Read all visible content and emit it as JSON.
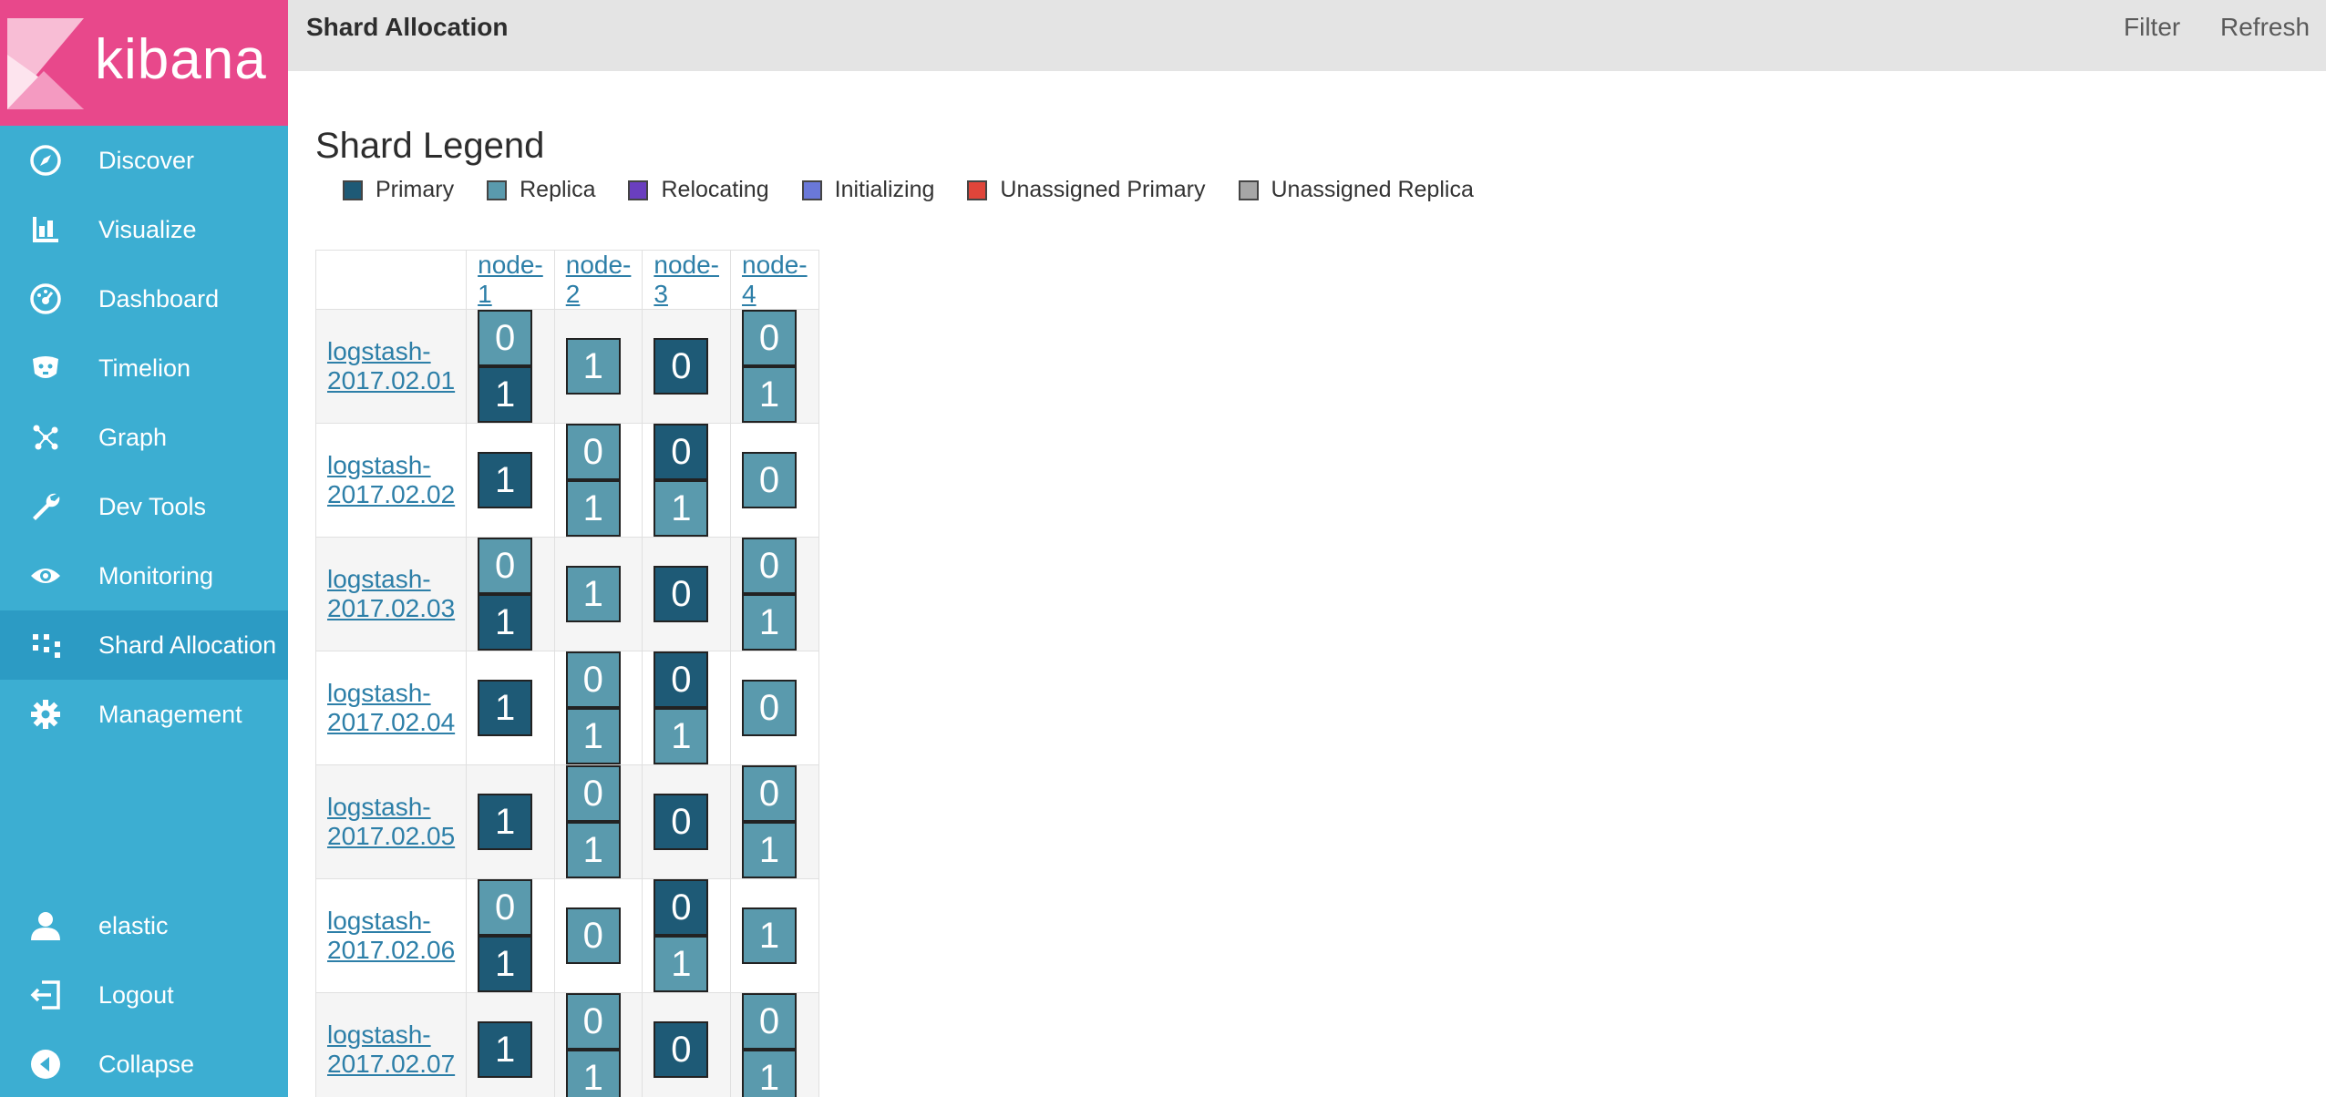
{
  "logo": {
    "text": "kibana"
  },
  "nav": {
    "items": [
      {
        "label": "Discover",
        "icon": "compass-icon",
        "active": false
      },
      {
        "label": "Visualize",
        "icon": "bar-chart-icon",
        "active": false
      },
      {
        "label": "Dashboard",
        "icon": "dashboard-icon",
        "active": false
      },
      {
        "label": "Timelion",
        "icon": "timelion-icon",
        "active": false
      },
      {
        "label": "Graph",
        "icon": "graph-icon",
        "active": false
      },
      {
        "label": "Dev Tools",
        "icon": "wrench-icon",
        "active": false
      },
      {
        "label": "Monitoring",
        "icon": "eye-icon",
        "active": false
      },
      {
        "label": "Shard Allocation",
        "icon": "shard-grid-icon",
        "active": true
      },
      {
        "label": "Management",
        "icon": "gear-icon",
        "active": false
      }
    ],
    "bottom": [
      {
        "label": "elastic",
        "icon": "user-icon"
      },
      {
        "label": "Logout",
        "icon": "logout-icon"
      },
      {
        "label": "Collapse",
        "icon": "collapse-icon"
      }
    ]
  },
  "topbar": {
    "title": "Shard Allocation",
    "filter": "Filter",
    "refresh": "Refresh"
  },
  "legend": {
    "title": "Shard Legend",
    "items": [
      {
        "label": "Primary",
        "color": "#1e5a76"
      },
      {
        "label": "Replica",
        "color": "#5a9aad"
      },
      {
        "label": "Relocating",
        "color": "#6a3fbf"
      },
      {
        "label": "Initializing",
        "color": "#6a78d8"
      },
      {
        "label": "Unassigned Primary",
        "color": "#e0453a"
      },
      {
        "label": "Unassigned Replica",
        "color": "#a6a6a6"
      }
    ]
  },
  "table": {
    "nodes": [
      "node-1",
      "node-2",
      "node-3",
      "node-4"
    ],
    "rows": [
      {
        "index": "logstash-2017.02.01",
        "cells": [
          [
            {
              "n": "0",
              "t": "replica"
            },
            {
              "n": "1",
              "t": "primary"
            }
          ],
          [
            {
              "n": "1",
              "t": "replica"
            }
          ],
          [
            {
              "n": "0",
              "t": "primary"
            }
          ],
          [
            {
              "n": "0",
              "t": "replica"
            },
            {
              "n": "1",
              "t": "replica"
            }
          ]
        ]
      },
      {
        "index": "logstash-2017.02.02",
        "cells": [
          [
            {
              "n": "1",
              "t": "primary"
            }
          ],
          [
            {
              "n": "0",
              "t": "replica"
            },
            {
              "n": "1",
              "t": "replica"
            }
          ],
          [
            {
              "n": "0",
              "t": "primary"
            },
            {
              "n": "1",
              "t": "replica"
            }
          ],
          [
            {
              "n": "0",
              "t": "replica"
            }
          ]
        ]
      },
      {
        "index": "logstash-2017.02.03",
        "cells": [
          [
            {
              "n": "0",
              "t": "replica"
            },
            {
              "n": "1",
              "t": "primary"
            }
          ],
          [
            {
              "n": "1",
              "t": "replica"
            }
          ],
          [
            {
              "n": "0",
              "t": "primary"
            }
          ],
          [
            {
              "n": "0",
              "t": "replica"
            },
            {
              "n": "1",
              "t": "replica"
            }
          ]
        ]
      },
      {
        "index": "logstash-2017.02.04",
        "cells": [
          [
            {
              "n": "1",
              "t": "primary"
            }
          ],
          [
            {
              "n": "0",
              "t": "replica"
            },
            {
              "n": "1",
              "t": "replica"
            }
          ],
          [
            {
              "n": "0",
              "t": "primary"
            },
            {
              "n": "1",
              "t": "replica"
            }
          ],
          [
            {
              "n": "0",
              "t": "replica"
            }
          ]
        ]
      },
      {
        "index": "logstash-2017.02.05",
        "cells": [
          [
            {
              "n": "1",
              "t": "primary"
            }
          ],
          [
            {
              "n": "0",
              "t": "replica"
            },
            {
              "n": "1",
              "t": "replica"
            }
          ],
          [
            {
              "n": "0",
              "t": "primary"
            }
          ],
          [
            {
              "n": "0",
              "t": "replica"
            },
            {
              "n": "1",
              "t": "replica"
            }
          ]
        ]
      },
      {
        "index": "logstash-2017.02.06",
        "cells": [
          [
            {
              "n": "0",
              "t": "replica"
            },
            {
              "n": "1",
              "t": "primary"
            }
          ],
          [
            {
              "n": "0",
              "t": "replica"
            }
          ],
          [
            {
              "n": "0",
              "t": "primary"
            },
            {
              "n": "1",
              "t": "replica"
            }
          ],
          [
            {
              "n": "1",
              "t": "replica"
            }
          ]
        ]
      },
      {
        "index": "logstash-2017.02.07",
        "cells": [
          [
            {
              "n": "1",
              "t": "primary"
            }
          ],
          [
            {
              "n": "0",
              "t": "replica"
            },
            {
              "n": "1",
              "t": "replica"
            }
          ],
          [
            {
              "n": "0",
              "t": "primary"
            }
          ],
          [
            {
              "n": "0",
              "t": "replica"
            },
            {
              "n": "1",
              "t": "replica"
            }
          ]
        ]
      }
    ]
  }
}
